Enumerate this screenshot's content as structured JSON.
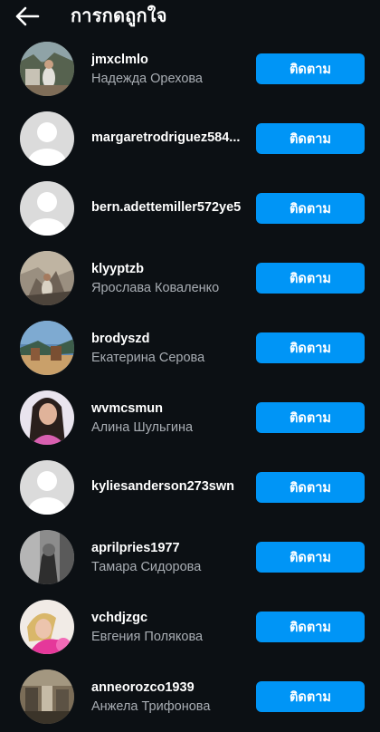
{
  "header": {
    "title": "การกดถูกใจ",
    "back_icon": "arrow-left-icon"
  },
  "colors": {
    "background": "#0c1014",
    "button": "#0095f6",
    "secondary_text": "#a8adb3",
    "placeholder_avatar": "#dbdbdb"
  },
  "users": [
    {
      "username": "jmxclmlo",
      "full_name": "Надежда Орехова",
      "button": "ติดตาม",
      "avatar": "photo"
    },
    {
      "username": "margaretrodriguez584...",
      "full_name": "",
      "button": "ติดตาม",
      "avatar": "default-avatar-icon"
    },
    {
      "username": "bern.adettemiller572ye5",
      "full_name": "",
      "button": "ติดตาม",
      "avatar": "default-avatar-icon"
    },
    {
      "username": "klyyptzb",
      "full_name": "Ярослава Коваленко",
      "button": "ติดตาม",
      "avatar": "photo"
    },
    {
      "username": "brodyszd",
      "full_name": "Екатерина Серова",
      "button": "ติดตาม",
      "avatar": "photo"
    },
    {
      "username": "wvmcsmun",
      "full_name": "Алина Шульгина",
      "button": "ติดตาม",
      "avatar": "photo"
    },
    {
      "username": "kyliesanderson273swn",
      "full_name": "",
      "button": "ติดตาม",
      "avatar": "default-avatar-icon"
    },
    {
      "username": "aprilpries1977",
      "full_name": "Тамара Сидорова",
      "button": "ติดตาม",
      "avatar": "photo"
    },
    {
      "username": "vchdjzgc",
      "full_name": "Евгения Полякова",
      "button": "ติดตาม",
      "avatar": "photo"
    },
    {
      "username": "anneorozco1939",
      "full_name": "Анжела Трифонова",
      "button": "ติดตาม",
      "avatar": "photo"
    }
  ]
}
